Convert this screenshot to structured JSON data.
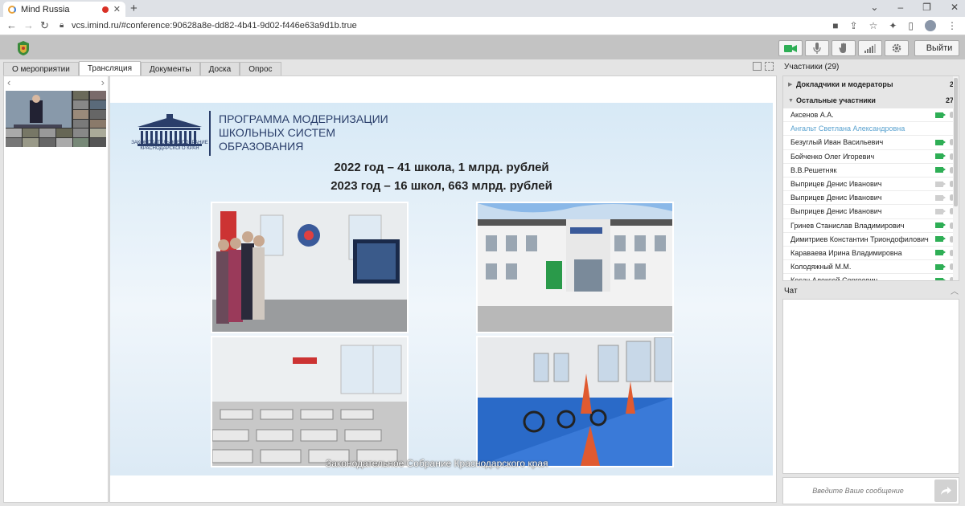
{
  "browser": {
    "tab_title": "Mind Russia",
    "tab_close": "✕",
    "new_tab": "+",
    "url": "vcs.imind.ru/#conference:90628a8e-dd82-4b41-9d02-f446e63a9d1b.true",
    "icons": [
      "back-icon",
      "forward-icon",
      "reload-icon",
      "lock-icon",
      "camera-permission-icon",
      "share-icon",
      "bookmark-star-icon",
      "extensions-icon",
      "sidebar-icon",
      "profile-icon",
      "menu-icon"
    ]
  },
  "header": {
    "exit_label": "Выйти",
    "controls": [
      "camera-icon",
      "microphone-icon",
      "raise-hand-icon",
      "signal-icon",
      "settings-gear-icon"
    ],
    "accent_color": "#2eae55"
  },
  "tabs": [
    {
      "label": "О мероприятии",
      "active": false
    },
    {
      "label": "Трансляция",
      "active": true
    },
    {
      "label": "Документы",
      "active": false
    },
    {
      "label": "Доска",
      "active": false
    },
    {
      "label": "Опрос",
      "active": false
    }
  ],
  "slide": {
    "logo_text": "ЗАКОНОДАТЕЛЬНОЕ СОБРАНИЕ КРАСНОДАРСКОГО КРАЯ",
    "program_title": "ПРОГРАММА МОДЕРНИЗАЦИИ ШКОЛЬНЫХ СИСТЕМ ОБРАЗОВАНИЯ",
    "line1": "2022 год – 41 школа, 1 млрд. рублей",
    "line2": "2023 год – 16 школ, 663 млрд. рублей",
    "caption": "Законодательное Собрание Краснодарского края"
  },
  "participants": {
    "title": "Участники (29)",
    "groups": [
      {
        "name": "Докладчики и модераторы",
        "count": "2",
        "expanded": false
      },
      {
        "name": "Остальные участники",
        "count": "27",
        "expanded": true
      }
    ],
    "list": [
      {
        "name": "Аксенов А.А.",
        "camera": true,
        "guest": false
      },
      {
        "name": "Ангальт Светлана Александровна",
        "camera": null,
        "guest": true
      },
      {
        "name": "Безуглый Иван Васильевич",
        "camera": true,
        "guest": false
      },
      {
        "name": "Бойченко Олег Игоревич",
        "camera": true,
        "guest": false
      },
      {
        "name": "В.В.Решетняк",
        "camera": true,
        "guest": false
      },
      {
        "name": "Выприцев Денис Иванович",
        "camera": false,
        "guest": false
      },
      {
        "name": "Выприцев Денис Иванович",
        "camera": false,
        "guest": false
      },
      {
        "name": "Выприцев Денис Иванович",
        "camera": false,
        "guest": false
      },
      {
        "name": "Гринев Станислав Владимирович",
        "camera": true,
        "guest": false
      },
      {
        "name": "Димитриев Константин Триондофилович",
        "camera": true,
        "guest": false
      },
      {
        "name": "Караваева Ирина Владимировна",
        "camera": true,
        "guest": false
      },
      {
        "name": "Колодяжный М.М.",
        "camera": true,
        "guest": false
      },
      {
        "name": "Косач Алексей Сергеевич",
        "camera": true,
        "guest": false
      }
    ]
  },
  "chat": {
    "title": "Чат",
    "placeholder": "Введите Ваше сообщение"
  }
}
